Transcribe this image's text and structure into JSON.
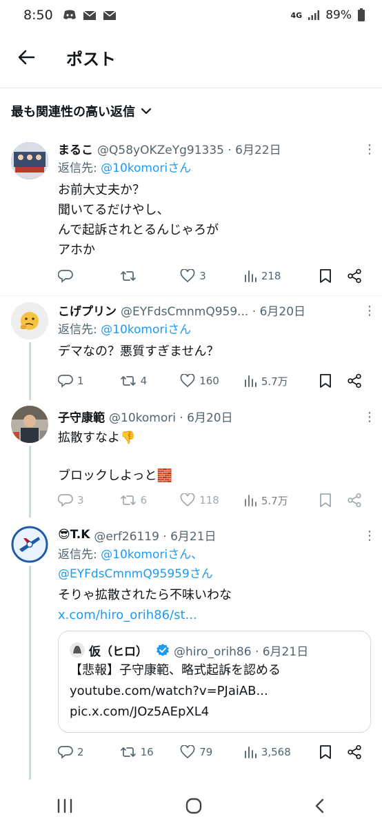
{
  "status_bar": {
    "time": "8:50",
    "network": "4G",
    "battery": "89%"
  },
  "header": {
    "title": "ポスト"
  },
  "sort": {
    "label": "最も関連性の高い返信"
  },
  "tweets": [
    {
      "name": "まるこ",
      "handle": "@Q58yOKZeYg91335 · 6月22日",
      "reply_prefix": "返信先: ",
      "reply_to": "@10komoriさん",
      "text": "お前大丈夫か？\n聞いてるだけやし、\nんで起訴されとるんじゃろが\nアホか",
      "replies": "",
      "retweets": "",
      "likes": "3",
      "views": "218"
    },
    {
      "name": "こげプリン",
      "handle": "@EYFdsCmnmQ959... · 6月20日",
      "reply_prefix": "返信先: ",
      "reply_to": "@10komoriさん",
      "text": "デマなの？悪質すぎません？",
      "replies": "1",
      "retweets": "4",
      "likes": "160",
      "views": "5.7万"
    },
    {
      "name": "子守康範",
      "handle": "@10komori · 6月20日",
      "text_line1": "拡散すなよ👎",
      "text_line2": "ブロックしよっと🧱",
      "replies": "3",
      "retweets": "6",
      "likes": "118",
      "views": "5.7万"
    },
    {
      "name": "😎T.K",
      "handle": "@erf26119 · 6月21日",
      "reply_prefix": "返信先: ",
      "reply_to_1": "@10komoriさん、",
      "reply_to_2": "@EYFdsCmnmQ95959さん",
      "text": "そりゃ拡散されたら不味いわな",
      "link": "x.com/hiro_orih86/st...",
      "quote": {
        "name": "仮（ヒロ）",
        "handle": "@hiro_orih86 · 6月21日",
        "line1": "【悲報】子守康範、略式起訴を認める",
        "line2": "youtube.com/watch?v=PJaiAB...",
        "line3": "pic.x.com/JOz5AEpXL4"
      },
      "replies": "2",
      "retweets": "16",
      "likes": "79",
      "views": "3,568"
    }
  ],
  "colors": {
    "link": "#1d9bf0",
    "muted": "#536471",
    "verified": "#1d9bf0"
  },
  "icons": [
    "back-arrow-icon",
    "chevron-down-icon",
    "more-icon",
    "reply-icon",
    "retweet-icon",
    "like-icon",
    "views-icon",
    "bookmark-icon",
    "share-icon",
    "verified-icon",
    "recents-icon",
    "home-icon",
    "nav-back-icon"
  ]
}
